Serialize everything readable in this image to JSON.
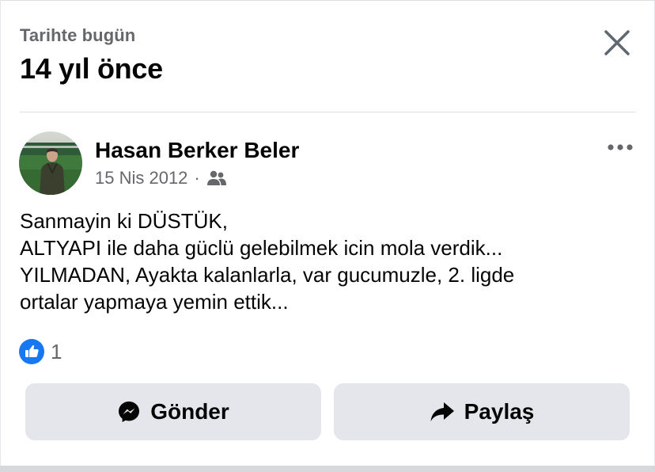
{
  "memory": {
    "section_label": "Tarihte bugün",
    "years_ago": "14 yıl önce"
  },
  "post": {
    "author": "Hasan Berker Beler",
    "date": "15 Nis 2012",
    "separator": "·",
    "audience_icon": "friends-icon",
    "text_lines": [
      "Sanmayin ki DÜSTÜK,",
      "ALTYAPI ile daha güclü gelebilmek icin mola verdik...",
      "YILMADAN, Ayakta kalanlarla, var gucumuzle, 2. ligde",
      "ortalar yapmaya yemin ettik..."
    ],
    "like_count": "1"
  },
  "actions": {
    "send_label": "Gönder",
    "share_label": "Paylaş"
  },
  "colors": {
    "like_blue": "#1877f2",
    "secondary_text": "#65676b",
    "button_bg": "#e4e6eb"
  }
}
